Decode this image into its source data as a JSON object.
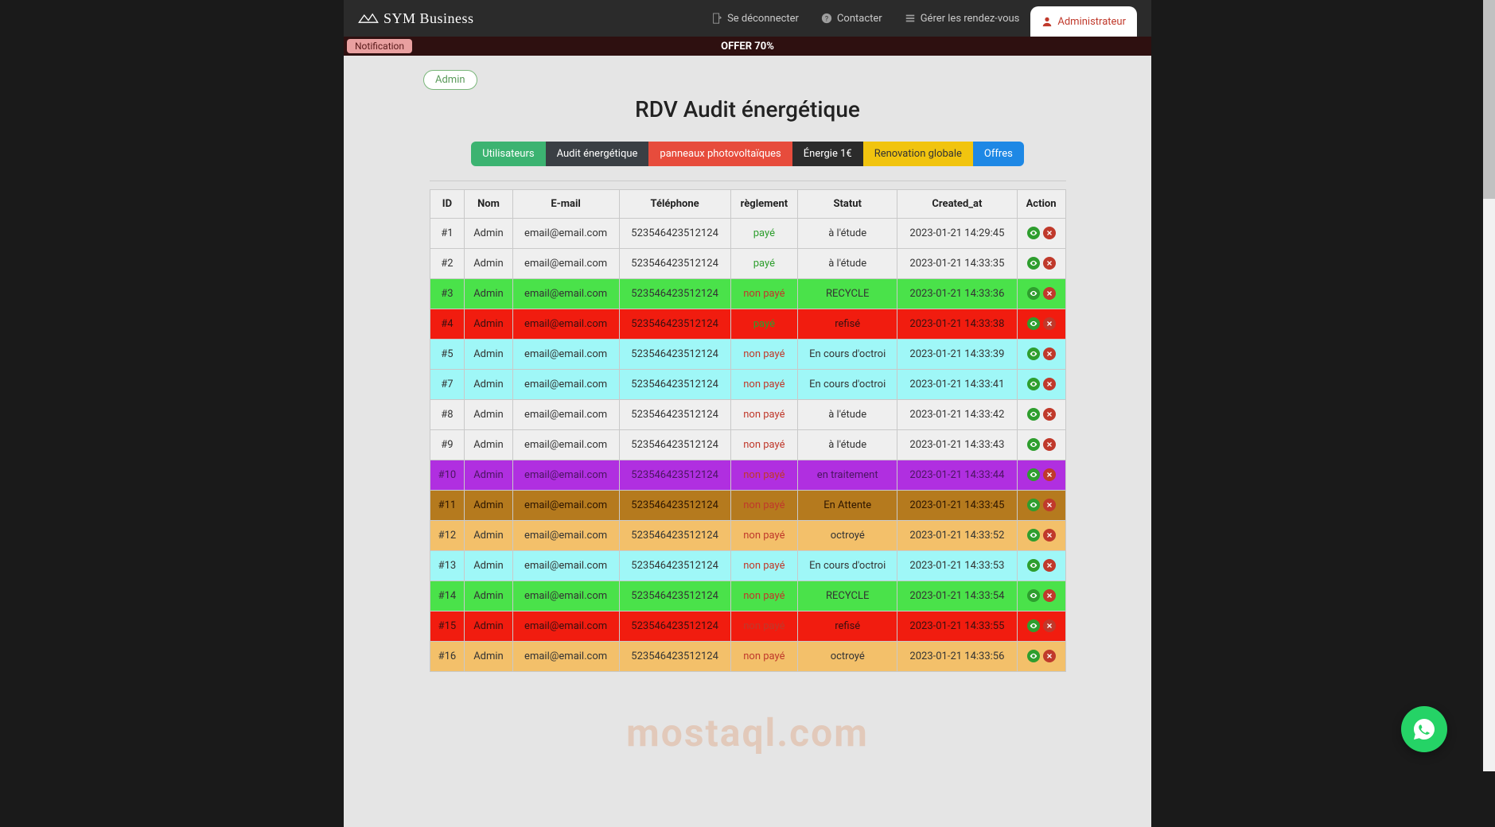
{
  "brand": "SYM Business",
  "nav": {
    "logout": "Se déconnecter",
    "contact": "Contacter",
    "manage": "Gérer les rendez-vous",
    "admin": "Administrateur"
  },
  "notification": {
    "label": "Notification",
    "offer": "OFFER 70%"
  },
  "admin_pill": "Admin",
  "page_title": "RDV Audit énergétique",
  "tabs": {
    "users": "Utilisateurs",
    "audit": "Audit énergétique",
    "solar": "panneaux photovoltaïques",
    "energy": "Énergie 1€",
    "reno": "Renovation globale",
    "offers": "Offres"
  },
  "table": {
    "headers": {
      "id": "ID",
      "name": "Nom",
      "email": "E-mail",
      "phone": "Téléphone",
      "payment": "règlement",
      "status": "Statut",
      "created": "Created_at",
      "action": "Action"
    },
    "rows": [
      {
        "id": "#1",
        "name": "Admin",
        "email": "email@email.com",
        "phone": "523546423512124",
        "pay": "payé",
        "pay_ok": true,
        "status": "à l'étude",
        "created": "2023-01-21 14:29:45",
        "cls": "row-default"
      },
      {
        "id": "#2",
        "name": "Admin",
        "email": "email@email.com",
        "phone": "523546423512124",
        "pay": "payé",
        "pay_ok": true,
        "status": "à l'étude",
        "created": "2023-01-21 14:33:35",
        "cls": "row-default"
      },
      {
        "id": "#3",
        "name": "Admin",
        "email": "email@email.com",
        "phone": "523546423512124",
        "pay": "non payé",
        "pay_ok": false,
        "status": "RECYCLE",
        "created": "2023-01-21 14:33:36",
        "cls": "row-green"
      },
      {
        "id": "#4",
        "name": "Admin",
        "email": "email@email.com",
        "phone": "523546423512124",
        "pay": "payé",
        "pay_ok": true,
        "status": "refisé",
        "created": "2023-01-21 14:33:38",
        "cls": "row-red"
      },
      {
        "id": "#5",
        "name": "Admin",
        "email": "email@email.com",
        "phone": "523546423512124",
        "pay": "non payé",
        "pay_ok": false,
        "status": "En cours d'octroi",
        "created": "2023-01-21 14:33:39",
        "cls": "row-cyan"
      },
      {
        "id": "#7",
        "name": "Admin",
        "email": "email@email.com",
        "phone": "523546423512124",
        "pay": "non payé",
        "pay_ok": false,
        "status": "En cours d'octroi",
        "created": "2023-01-21 14:33:41",
        "cls": "row-cyan"
      },
      {
        "id": "#8",
        "name": "Admin",
        "email": "email@email.com",
        "phone": "523546423512124",
        "pay": "non payé",
        "pay_ok": false,
        "status": "à l'étude",
        "created": "2023-01-21 14:33:42",
        "cls": "row-default"
      },
      {
        "id": "#9",
        "name": "Admin",
        "email": "email@email.com",
        "phone": "523546423512124",
        "pay": "non payé",
        "pay_ok": false,
        "status": "à l'étude",
        "created": "2023-01-21 14:33:43",
        "cls": "row-default"
      },
      {
        "id": "#10",
        "name": "Admin",
        "email": "email@email.com",
        "phone": "523546423512124",
        "pay": "non payé",
        "pay_ok": false,
        "status": "en traitement",
        "created": "2023-01-21 14:33:44",
        "cls": "row-purple"
      },
      {
        "id": "#11",
        "name": "Admin",
        "email": "email@email.com",
        "phone": "523546423512124",
        "pay": "non payé",
        "pay_ok": false,
        "status": "En Attente",
        "created": "2023-01-21 14:33:45",
        "cls": "row-brown"
      },
      {
        "id": "#12",
        "name": "Admin",
        "email": "email@email.com",
        "phone": "523546423512124",
        "pay": "non payé",
        "pay_ok": false,
        "status": "octroyé",
        "created": "2023-01-21 14:33:52",
        "cls": "row-orange"
      },
      {
        "id": "#13",
        "name": "Admin",
        "email": "email@email.com",
        "phone": "523546423512124",
        "pay": "non payé",
        "pay_ok": false,
        "status": "En cours d'octroi",
        "created": "2023-01-21 14:33:53",
        "cls": "row-cyan"
      },
      {
        "id": "#14",
        "name": "Admin",
        "email": "email@email.com",
        "phone": "523546423512124",
        "pay": "non payé",
        "pay_ok": false,
        "status": "RECYCLE",
        "created": "2023-01-21 14:33:54",
        "cls": "row-green"
      },
      {
        "id": "#15",
        "name": "Admin",
        "email": "email@email.com",
        "phone": "523546423512124",
        "pay": "non payé",
        "pay_ok": false,
        "status": "refisé",
        "created": "2023-01-21 14:33:55",
        "cls": "row-red"
      },
      {
        "id": "#16",
        "name": "Admin",
        "email": "email@email.com",
        "phone": "523546423512124",
        "pay": "non payé",
        "pay_ok": false,
        "status": "octroyé",
        "created": "2023-01-21 14:33:56",
        "cls": "row-orange"
      }
    ]
  },
  "watermark": "mostaql.com"
}
